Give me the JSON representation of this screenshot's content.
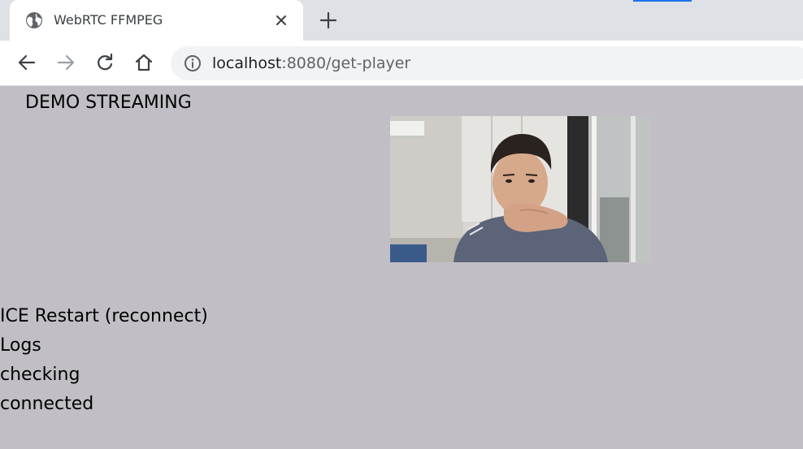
{
  "browser": {
    "tab": {
      "title": "WebRTC FFMPEG",
      "favicon": "globe-icon"
    },
    "address_bar": {
      "host": "localhost",
      "path": ":8080/get-player"
    },
    "icons": {
      "back": "back-arrow-icon",
      "forward": "forward-arrow-icon",
      "reload": "reload-icon",
      "home": "home-icon",
      "info": "info-icon",
      "close": "close-icon",
      "new_tab": "plus-icon"
    }
  },
  "page": {
    "heading": "DEMO STREAMING",
    "ice_restart_label": "ICE Restart (reconnect)",
    "logs_heading": "Logs",
    "log_entries": [
      "checking",
      "connected"
    ],
    "video": {
      "content": "webcam feed"
    }
  },
  "colors": {
    "page_background": "#c1bfc5",
    "tabstrip_background": "#dee1e6",
    "accent": "#1a73e8"
  }
}
